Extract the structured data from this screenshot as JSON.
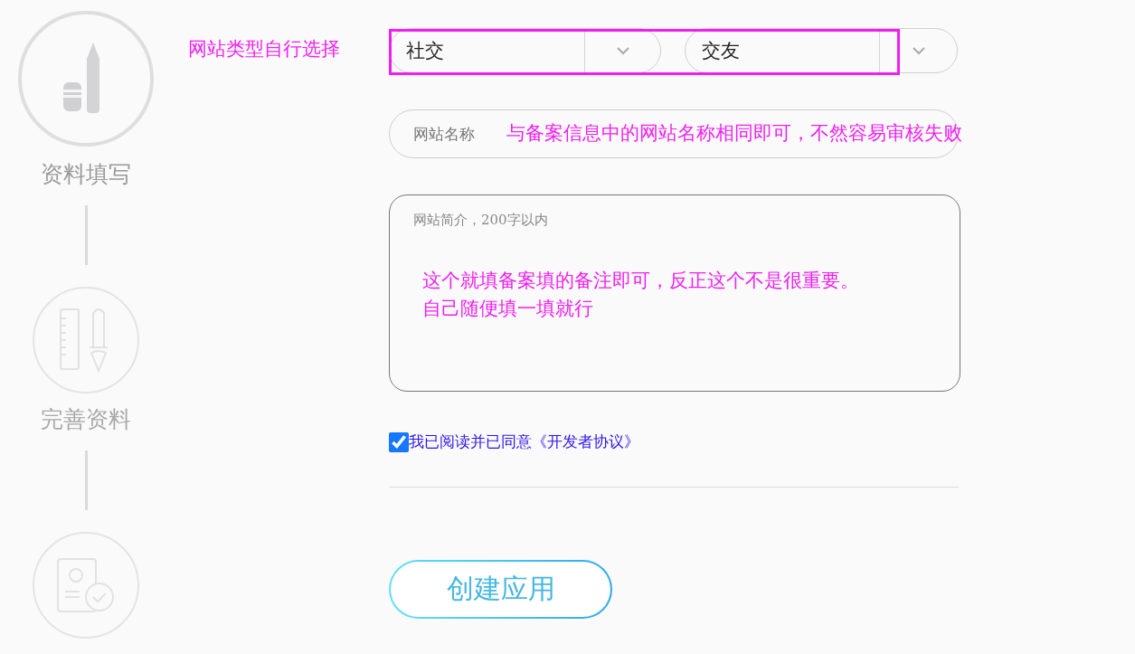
{
  "steps": [
    {
      "label": "资料填写",
      "current": true,
      "kind": "write"
    },
    {
      "label": "完善资料",
      "current": false,
      "kind": "tools"
    },
    {
      "current": false,
      "kind": "document"
    }
  ],
  "type_hint": "网站类型自行选择",
  "selects": [
    {
      "value": "社交"
    },
    {
      "value": "交友"
    }
  ],
  "name_field": {
    "placeholder": "网站名称",
    "hint": "与备案信息中的网站名称相同即可，不然容易审核失败"
  },
  "intro_field": {
    "placeholder": "网站简介，200字以内",
    "hint_lines": [
      "这个就填备案填的备注即可，反正这个不是很重要。",
      "自己随便填一填就行"
    ]
  },
  "agreement": {
    "checked": true,
    "text": "我已阅读并已同意《开发者协议》"
  },
  "submit": {
    "label": "创建应用"
  }
}
